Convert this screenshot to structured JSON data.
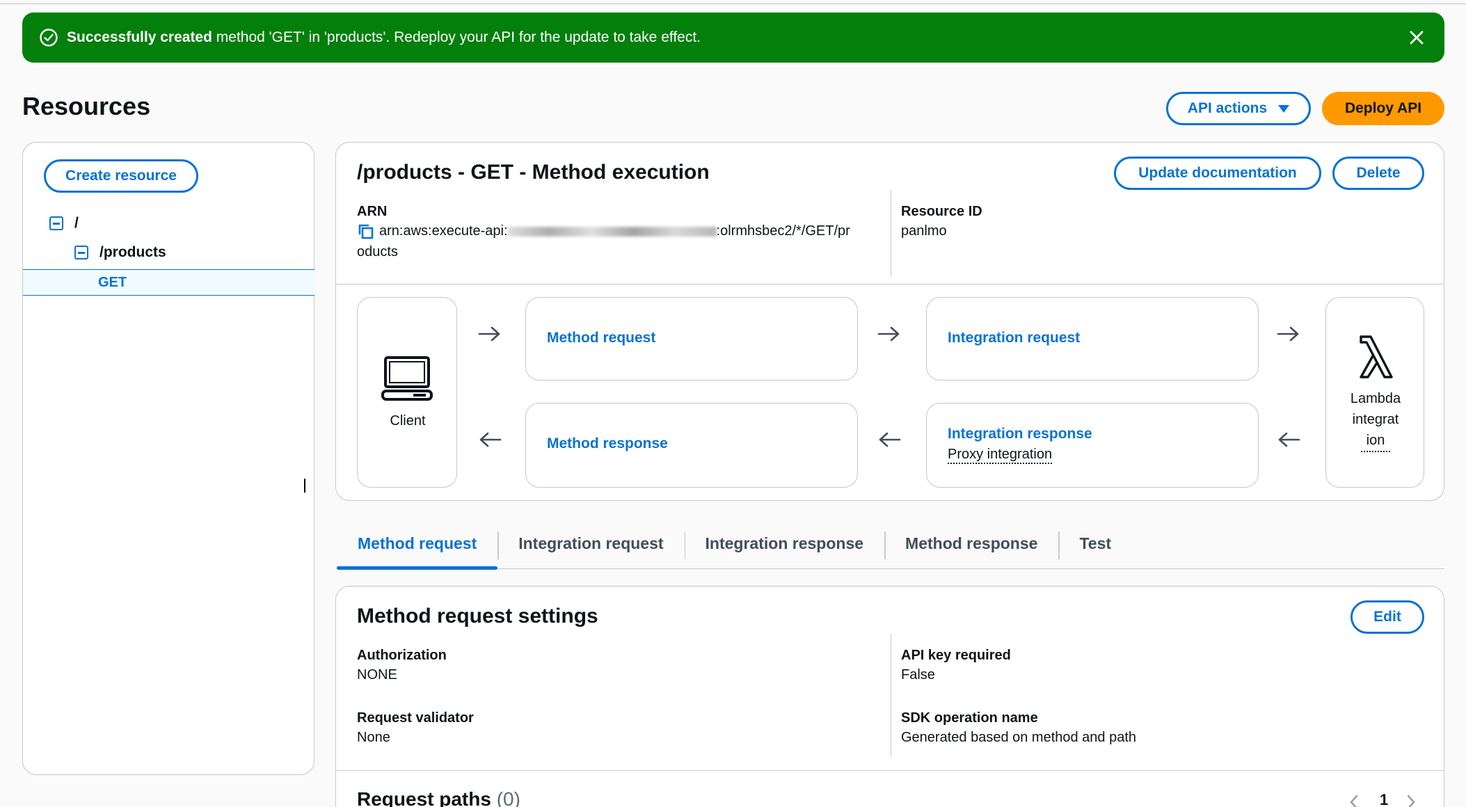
{
  "flash": {
    "strong": "Successfully created",
    "message": "method 'GET' in 'products'. Redeploy your API for the update to take effect."
  },
  "header": {
    "title": "Resources",
    "api_actions": "API actions",
    "deploy": "Deploy API"
  },
  "sidebar": {
    "create_resource": "Create resource",
    "tree": [
      {
        "label": "/"
      },
      {
        "label": "/products"
      },
      {
        "label": "GET"
      }
    ]
  },
  "execution": {
    "title": "/products - GET - Method execution",
    "update_doc": "Update documentation",
    "delete": "Delete",
    "arn_label": "ARN",
    "arn_prefix": "arn:aws:execute-api:",
    "arn_suffix_line1": ":olrmhsbec2/*/GET/pr",
    "arn_suffix_line2": "oducts",
    "resource_id_label": "Resource ID",
    "resource_id": "panlmo",
    "client": "Client",
    "method_request": "Method request",
    "integration_request": "Integration request",
    "method_response": "Method response",
    "integration_response": "Integration response",
    "proxy_integration": "Proxy integration",
    "lambda_line1": "Lambda",
    "lambda_line2": "integrat",
    "lambda_line3": "ion"
  },
  "tabs": [
    {
      "label": "Method request",
      "active": true
    },
    {
      "label": "Integration request"
    },
    {
      "label": "Integration response"
    },
    {
      "label": "Method response"
    },
    {
      "label": "Test"
    }
  ],
  "settings": {
    "title": "Method request settings",
    "edit": "Edit",
    "authorization_label": "Authorization",
    "authorization": "NONE",
    "api_key_label": "API key required",
    "api_key": "False",
    "validator_label": "Request validator",
    "validator": "None",
    "sdk_label": "SDK operation name",
    "sdk": "Generated based on method and path",
    "request_paths": "Request paths",
    "request_paths_count": "(0)",
    "page": "1"
  },
  "colors": {
    "success": "#037f0c",
    "link": "#0972d3",
    "primary": "#ff9900"
  }
}
